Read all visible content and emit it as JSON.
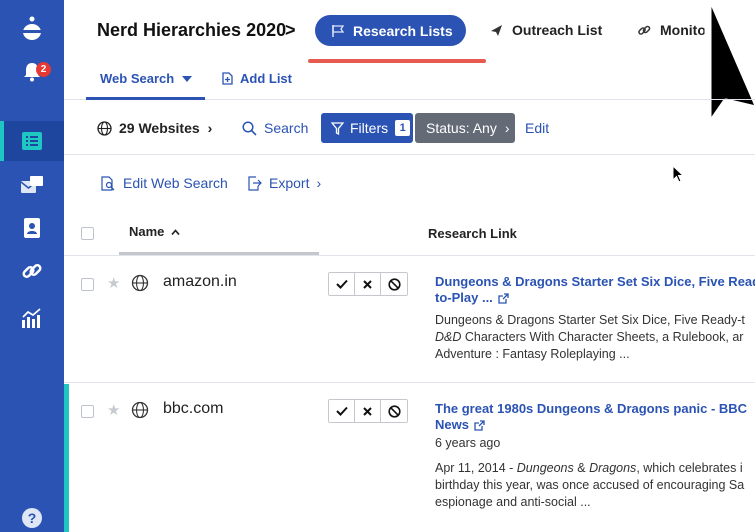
{
  "sidebar": {
    "notification_count": "2",
    "help_label": "?"
  },
  "header": {
    "project_title": "Nerd Hierarchies 2020",
    "chevron": ">",
    "tabs": {
      "research_lists": "Research Lists",
      "outreach_list": "Outreach List",
      "monitor": "Monitor"
    }
  },
  "subtabs": {
    "web_search": "Web Search",
    "add_list": "Add List"
  },
  "toolbar": {
    "websites_count": "29 Websites",
    "search": "Search",
    "filters": "Filters",
    "filters_count": "1",
    "status": "Status: Any",
    "edit": "Edit"
  },
  "actions": {
    "edit_web_search": "Edit Web Search",
    "export": "Export"
  },
  "table": {
    "columns": {
      "name": "Name",
      "research_link": "Research Link"
    },
    "rows": [
      {
        "domain": "amazon.in",
        "link_title_line1": "Dungeons & Dragons Starter Set Six Dice, Five Read",
        "link_title_line2": "to-Play ...",
        "snippet_line1": "Dungeons & Dragons Starter Set Six Dice, Five Ready-t",
        "snippet_line2_em": "D&D",
        "snippet_line2": " Characters With Character Sheets, a Rulebook, ar",
        "snippet_line3": "Adventure : Fantasy Roleplaying ..."
      },
      {
        "domain": "bbc.com",
        "link_title_line1": "The great 1980s Dungeons & Dragons panic - BBC",
        "link_title_line2": "News",
        "age": "6 years ago",
        "snippet_prefix": "Apr 11, 2014 - ",
        "snippet_em1": "Dungeons",
        "snippet_mid": " & ",
        "snippet_em2": "Dragons",
        "snippet_rest": ", which celebrates i",
        "snippet_line2": "birthday this year, was once accused of encouraging Sa",
        "snippet_line3": "espionage and anti-social ..."
      }
    ]
  },
  "colors": {
    "brand_blue": "#2a53b3",
    "accent_teal": "#1ec7c2",
    "highlight_red": "#e65a50",
    "status_gray": "#646b76"
  }
}
